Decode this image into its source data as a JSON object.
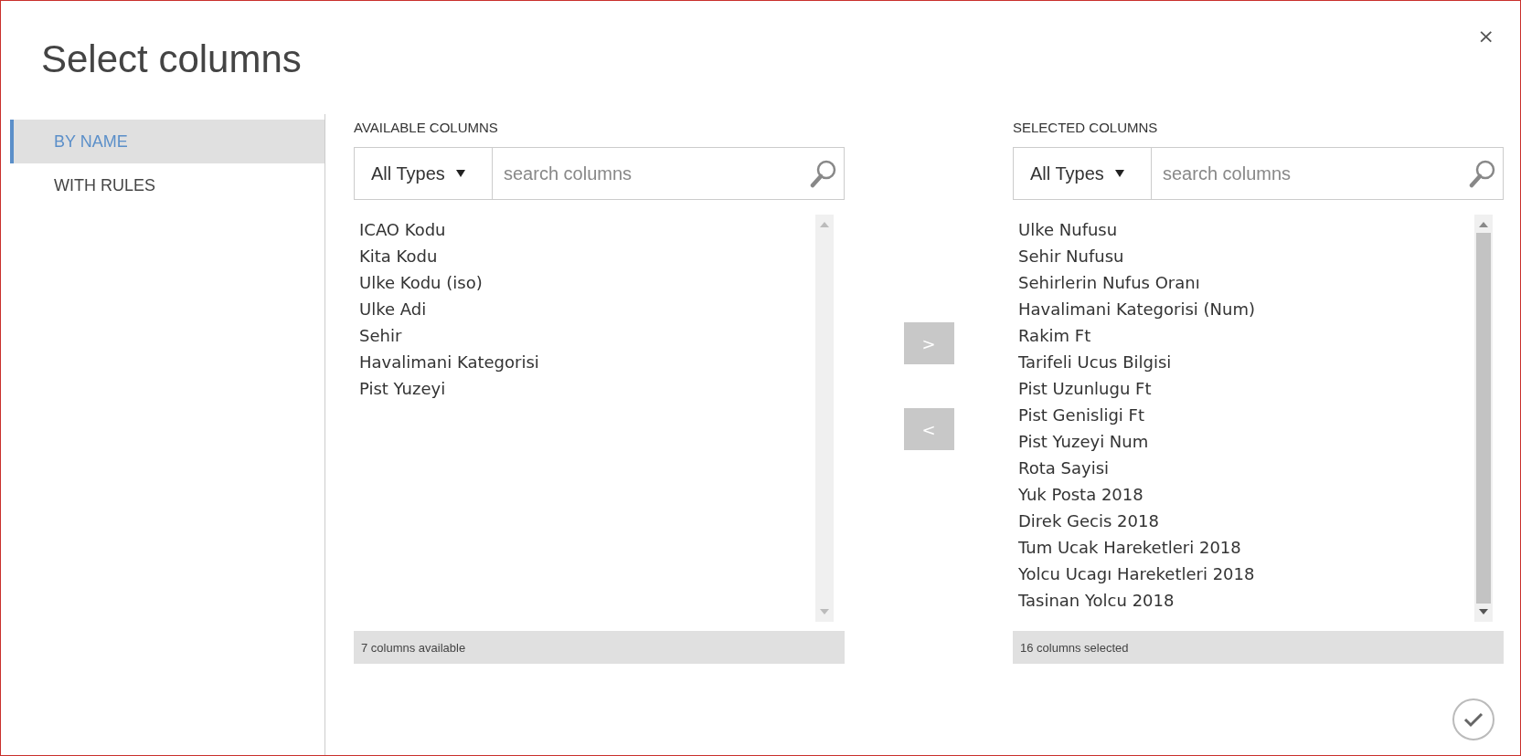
{
  "dialog": {
    "title": "Select columns",
    "close": "×"
  },
  "modes": [
    {
      "label": "BY NAME",
      "selected": true
    },
    {
      "label": "WITH RULES",
      "selected": false
    }
  ],
  "panels": [
    {
      "heading": "AVAILABLE COLUMNS",
      "type_filter": "All Types",
      "search": {
        "placeholder": "search columns"
      },
      "scroll_thumb": false,
      "items": [
        "ICAO Kodu",
        "Kita Kodu",
        "Ulke Kodu (iso)",
        "Ulke Adi",
        "Sehir",
        "Havalimani Kategorisi",
        "Pist Yuzeyi"
      ],
      "footer": "7 columns available"
    },
    {
      "heading": "SELECTED COLUMNS",
      "type_filter": "All Types",
      "search": {
        "placeholder": "search columns"
      },
      "scroll_thumb": true,
      "items": [
        "Ulke Nufusu",
        "Sehir Nufusu",
        "Sehirlerin Nufus Oranı",
        "Havalimani Kategorisi (Num)",
        "Rakim Ft",
        "Tarifeli Ucus Bilgisi",
        "Pist Uzunlugu Ft",
        "Pist Genisligi Ft",
        "Pist Yuzeyi Num",
        "Rota Sayisi",
        "Yuk Posta 2018",
        "Direk Gecis 2018",
        "Tum Ucak Hareketleri 2018",
        "Yolcu Ucagı Hareketleri 2018",
        "Tasinan Yolcu 2018"
      ],
      "footer": "16 columns selected"
    }
  ],
  "transfer_buttons": [
    ">",
    "<"
  ]
}
